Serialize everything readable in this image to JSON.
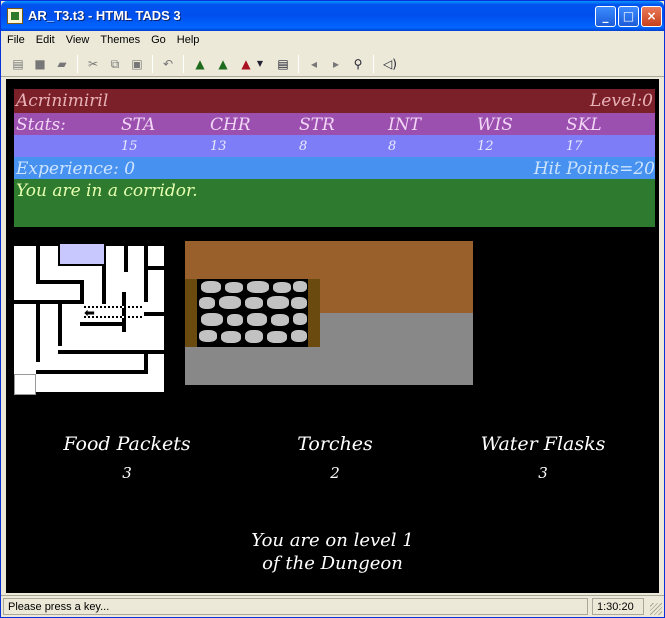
{
  "window": {
    "title": "AR_T3.t3 - HTML TADS 3",
    "minimize": "_",
    "maximize": "□",
    "close": "×"
  },
  "menu": [
    "File",
    "Edit",
    "View",
    "Themes",
    "Go",
    "Help"
  ],
  "toolbar_icons": [
    "open-story-icon",
    "save-icon",
    "restore-icon",
    "cut-icon",
    "copy-icon",
    "paste-icon",
    "undo-icon",
    "play-icon",
    "play-alt-icon",
    "play-stop-icon",
    "transcript-icon",
    "back-icon",
    "forward-icon",
    "find-icon",
    "sound-icon"
  ],
  "character": {
    "name": "Acrinimiril",
    "level_label": "Level:0",
    "stats_label": "Stats:",
    "stats": [
      {
        "name": "STA",
        "value": "15"
      },
      {
        "name": "CHR",
        "value": "13"
      },
      {
        "name": "STR",
        "value": "8"
      },
      {
        "name": "INT",
        "value": "8"
      },
      {
        "name": "WIS",
        "value": "12"
      },
      {
        "name": "SKL",
        "value": "17"
      }
    ],
    "experience": "Experience: 0",
    "hit_points": "Hit Points=20",
    "location": "You are in a corridor."
  },
  "inventory": [
    {
      "label": "Food Packets",
      "count": "3"
    },
    {
      "label": "Torches",
      "count": "2"
    },
    {
      "label": "Water Flasks",
      "count": "3"
    }
  ],
  "level_message": {
    "line1": "You are on level 1",
    "line2": "of the Dungeon"
  },
  "status": {
    "message": "Please press a key...",
    "time": "1:30:20"
  },
  "colors": {
    "name_bar": "#7b2028",
    "stats_bar": "#9b4fae",
    "values_bar": "#7d7ef7",
    "experience_bar": "#4791f0",
    "location_bar": "#2e7a2e"
  }
}
